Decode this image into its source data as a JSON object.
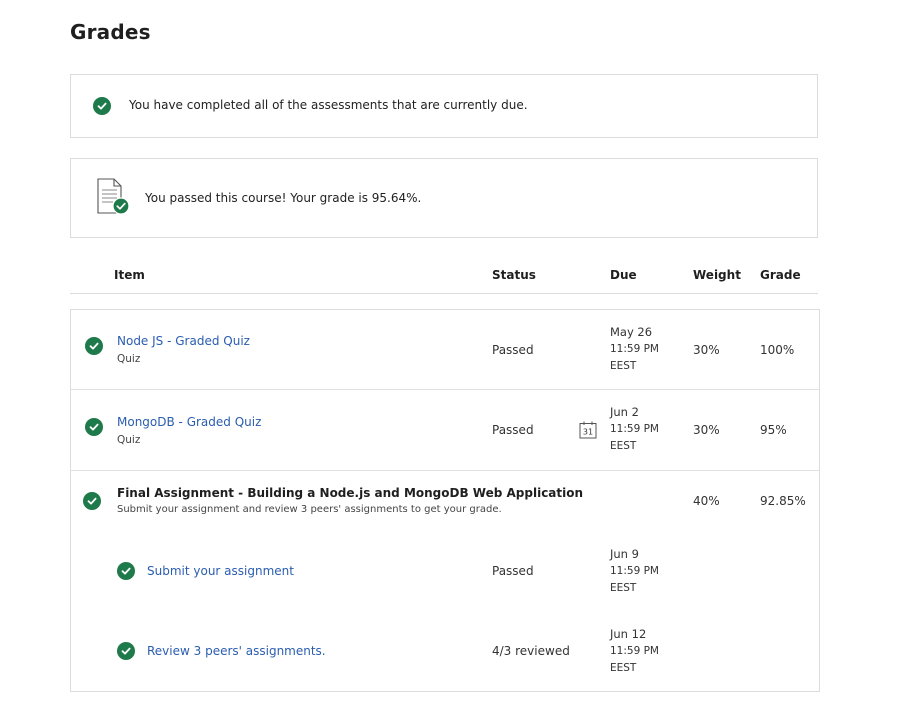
{
  "page": {
    "title": "Grades"
  },
  "banners": {
    "due_message": "You have completed all of the assessments that are currently due.",
    "pass_message": "You passed this course! Your grade is 95.64%."
  },
  "table": {
    "headers": {
      "item": "Item",
      "status": "Status",
      "due": "Due",
      "weight": "Weight",
      "grade": "Grade"
    },
    "rows": [
      {
        "title": "Node JS - Graded Quiz",
        "type": "Quiz",
        "status": "Passed",
        "due_date": "May 26",
        "due_time": "11:59 PM",
        "due_tz": "EEST",
        "weight": "30%",
        "grade": "100%"
      },
      {
        "title": "MongoDB - Graded Quiz",
        "type": "Quiz",
        "status": "Passed",
        "due_date": "Jun 2",
        "due_time": "11:59 PM",
        "due_tz": "EEST",
        "weight": "30%",
        "grade": "95%",
        "calendar_icon": "31"
      },
      {
        "title": "Final Assignment - Building a Node.js and MongoDB Web Application",
        "description": "Submit your assignment and review 3 peers' assignments to get your grade.",
        "weight": "40%",
        "grade": "92.85%"
      }
    ],
    "subrows": [
      {
        "title": "Submit your assignment",
        "status": "Passed",
        "due_date": "Jun 9",
        "due_time": "11:59 PM",
        "due_tz": "EEST"
      },
      {
        "title": "Review 3 peers' assignments.",
        "status": "4/3 reviewed",
        "due_date": "Jun 12",
        "due_time": "11:59 PM",
        "due_tz": "EEST"
      }
    ]
  },
  "colors": {
    "check": "#1f7a4b",
    "link": "#2a5db0",
    "border": "#dcdcdc"
  },
  "icons": {
    "status": "check-circle-icon",
    "document": "document-check-icon",
    "calendar": "calendar-icon"
  }
}
